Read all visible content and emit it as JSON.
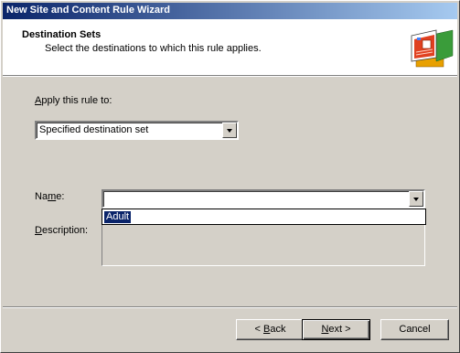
{
  "window": {
    "title": "New Site and Content Rule Wizard"
  },
  "header": {
    "title": "Destination Sets",
    "subtitle": "Select the destinations to which this rule applies."
  },
  "apply": {
    "label_prefix": "",
    "label_mnemonic": "A",
    "label_rest": "pply this rule to:",
    "selected_value": "Specified destination set"
  },
  "name": {
    "label_prefix": "Na",
    "label_mnemonic": "m",
    "label_rest": "e:",
    "value": "",
    "dropdown_options": [
      "Adult"
    ]
  },
  "description": {
    "label_prefix": "",
    "label_mnemonic": "D",
    "label_rest": "escription:",
    "value": ""
  },
  "buttons": {
    "back": {
      "prefix": "< ",
      "mnemonic": "B",
      "rest": "ack"
    },
    "next": {
      "prefix": "",
      "mnemonic": "N",
      "rest": "ext >"
    },
    "cancel": "Cancel"
  },
  "colors": {
    "title_bar_start": "#0a246a",
    "title_bar_end": "#a6caf0",
    "selection": "#0a246a",
    "dialog_face": "#d4d0c8"
  },
  "icons": {
    "wizard": "wizard-web-pages-icon",
    "dropdown": "chevron-down-icon"
  }
}
